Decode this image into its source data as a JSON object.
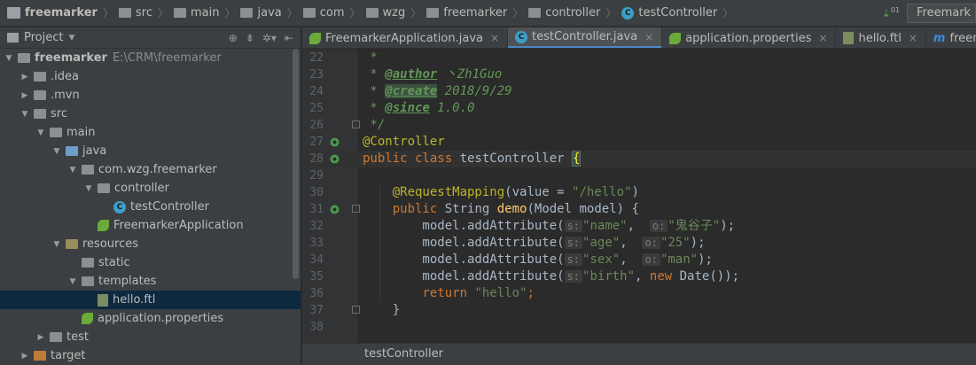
{
  "breadcrumb": [
    "freemarker",
    "src",
    "main",
    "java",
    "com",
    "wzg",
    "freemarker",
    "controller",
    "testController"
  ],
  "nav_right": {
    "run_config": "Freemark"
  },
  "project_panel": {
    "title": "Project"
  },
  "tree": [
    {
      "label": "freemarker",
      "path": "E:\\CRM\\freemarker",
      "depth": 0,
      "expanded": true,
      "icon": "folder",
      "bold": true
    },
    {
      "label": ".idea",
      "depth": 1,
      "expanded": false,
      "icon": "folder"
    },
    {
      "label": ".mvn",
      "depth": 1,
      "expanded": false,
      "icon": "folder"
    },
    {
      "label": "src",
      "depth": 1,
      "expanded": true,
      "icon": "folder"
    },
    {
      "label": "main",
      "depth": 2,
      "expanded": true,
      "icon": "folder"
    },
    {
      "label": "java",
      "depth": 3,
      "expanded": true,
      "icon": "source-folder"
    },
    {
      "label": "com.wzg.freemarker",
      "depth": 4,
      "expanded": true,
      "icon": "folder"
    },
    {
      "label": "controller",
      "depth": 5,
      "expanded": true,
      "icon": "folder"
    },
    {
      "label": "testController",
      "depth": 6,
      "icon": "class"
    },
    {
      "label": "FreemarkerApplication",
      "depth": 5,
      "icon": "spring-class"
    },
    {
      "label": "resources",
      "depth": 3,
      "expanded": true,
      "icon": "resources-folder"
    },
    {
      "label": "static",
      "depth": 4,
      "expanded": false,
      "icon": "folder",
      "no_arrow": true
    },
    {
      "label": "templates",
      "depth": 4,
      "expanded": true,
      "icon": "folder"
    },
    {
      "label": "hello.ftl",
      "depth": 5,
      "icon": "ftl-file",
      "selected": true
    },
    {
      "label": "application.properties",
      "depth": 4,
      "icon": "properties-file"
    },
    {
      "label": "test",
      "depth": 2,
      "expanded": false,
      "icon": "folder"
    },
    {
      "label": "target",
      "depth": 1,
      "expanded": false,
      "icon": "target-folder"
    }
  ],
  "tabs": [
    {
      "label": "FreemarkerApplication.java",
      "icon": "spring-class",
      "active": false
    },
    {
      "label": "testController.java",
      "icon": "class",
      "active": true
    },
    {
      "label": "application.properties",
      "icon": "properties-file",
      "active": false
    },
    {
      "label": "hello.ftl",
      "icon": "ftl-file",
      "active": false
    },
    {
      "label": "freemarker",
      "icon": "maven",
      "active": false
    }
  ],
  "close_glyph": "×",
  "code_lines": [
    {
      "n": "22",
      "tokens": [
        [
          "cm",
          " *"
        ]
      ]
    },
    {
      "n": "23",
      "tokens": [
        [
          "cm",
          " * "
        ],
        [
          "tag",
          "@author"
        ],
        [
          "cm",
          " 丶Zh1Guo"
        ]
      ]
    },
    {
      "n": "24",
      "tokens": [
        [
          "cm",
          " * "
        ],
        [
          "tag hl",
          "@create"
        ],
        [
          "cm",
          " 2018/9/29"
        ]
      ]
    },
    {
      "n": "25",
      "tokens": [
        [
          "cm",
          " * "
        ],
        [
          "tag",
          "@since"
        ],
        [
          "cm",
          " 1.0.0"
        ]
      ]
    },
    {
      "n": "26",
      "tokens": [
        [
          "cm",
          " */"
        ]
      ],
      "fold": true
    },
    {
      "n": "27",
      "tokens": [
        [
          "anno",
          "@Controller"
        ]
      ],
      "mark": "spring"
    },
    {
      "n": "28",
      "tokens": [
        [
          "kw",
          "public class "
        ],
        [
          "plain",
          "testController "
        ],
        [
          "brace",
          "{"
        ]
      ],
      "mark": "spring",
      "current": true
    },
    {
      "n": "29",
      "tokens": []
    },
    {
      "n": "30",
      "tokens": [
        [
          "plain",
          "    "
        ],
        [
          "anno",
          "@RequestMapping"
        ],
        [
          "plain",
          "(value = "
        ],
        [
          "str",
          "\"/hello\""
        ],
        [
          "plain",
          ")"
        ]
      ]
    },
    {
      "n": "31",
      "tokens": [
        [
          "plain",
          "    "
        ],
        [
          "kw",
          "public "
        ],
        [
          "plain",
          "String "
        ],
        [
          "fn",
          "demo"
        ],
        [
          "plain",
          "(Model model) {"
        ]
      ],
      "mark": "spring",
      "fold": true
    },
    {
      "n": "32",
      "tokens": [
        [
          "plain",
          "        model.addAttribute("
        ],
        [
          "hint",
          "s:"
        ],
        [
          "str",
          "\"name\""
        ],
        [
          "plain",
          ",  "
        ],
        [
          "hint",
          "o:"
        ],
        [
          "str",
          "\"鬼谷子\""
        ],
        [
          "plain",
          ");"
        ]
      ]
    },
    {
      "n": "33",
      "tokens": [
        [
          "plain",
          "        model.addAttribute("
        ],
        [
          "hint",
          "s:"
        ],
        [
          "str",
          "\"age\""
        ],
        [
          "plain",
          ",  "
        ],
        [
          "hint",
          "o:"
        ],
        [
          "str",
          "\"25\""
        ],
        [
          "plain",
          ");"
        ]
      ]
    },
    {
      "n": "34",
      "tokens": [
        [
          "plain",
          "        model.addAttribute("
        ],
        [
          "hint",
          "s:"
        ],
        [
          "str",
          "\"sex\""
        ],
        [
          "plain",
          ",  "
        ],
        [
          "hint",
          "o:"
        ],
        [
          "str",
          "\"man\""
        ],
        [
          "plain",
          ");"
        ]
      ]
    },
    {
      "n": "35",
      "tokens": [
        [
          "plain",
          "        model.addAttribute("
        ],
        [
          "hint",
          "s:"
        ],
        [
          "str",
          "\"birth\""
        ],
        [
          "plain",
          ", "
        ],
        [
          "kw",
          "new "
        ],
        [
          "plain",
          "Date());"
        ]
      ]
    },
    {
      "n": "36",
      "tokens": [
        [
          "plain",
          "        "
        ],
        [
          "kw",
          "return "
        ],
        [
          "str",
          "\"hello\""
        ],
        [
          "kw",
          ";"
        ]
      ]
    },
    {
      "n": "37",
      "tokens": [
        [
          "plain",
          "    }"
        ]
      ],
      "fold": true
    },
    {
      "n": "38",
      "tokens": []
    }
  ],
  "editor_footer": "testController"
}
